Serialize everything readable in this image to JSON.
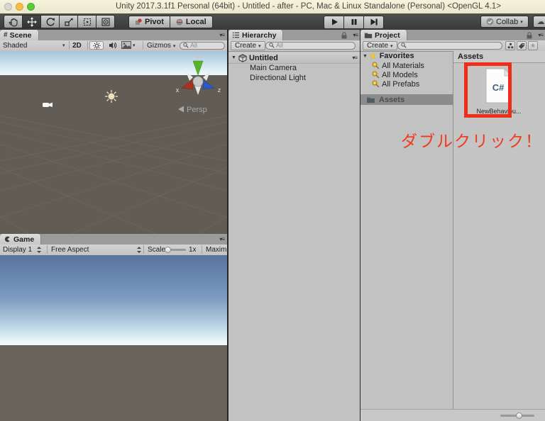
{
  "window": {
    "title": "Unity 2017.3.1f1 Personal (64bit) - Untitled - after - PC, Mac & Linux Standalone (Personal) <OpenGL 4.1>"
  },
  "toolbar": {
    "pivot": "Pivot",
    "local": "Local",
    "collab": "Collab"
  },
  "icons": {
    "dropdown": "▾",
    "panel_menu": "▾≡",
    "expanded": "▼",
    "star": "★",
    "cloud": "☁",
    "hash": "#"
  },
  "scene": {
    "tab": "Scene",
    "shaded": "Shaded",
    "btn_2d": "2D",
    "gizmos": "Gizmos",
    "search_text": "All",
    "persp": "Persp",
    "axis_x": "x",
    "axis_y": "y",
    "axis_z": "z"
  },
  "game": {
    "tab": "Game",
    "display": "Display 1",
    "aspect": "Free Aspect",
    "scale_label": "Scale",
    "scale_value": "1x",
    "maximize": "Maximiz"
  },
  "hierarchy": {
    "tab": "Hierarchy",
    "create": "Create",
    "search_text": "All",
    "scene_name": "Untitled",
    "items": [
      "Main Camera",
      "Directional Light"
    ]
  },
  "project": {
    "tab": "Project",
    "create": "Create",
    "favorites": "Favorites",
    "favorite_items": [
      "All Materials",
      "All Models",
      "All Prefabs"
    ],
    "assets_folder": "Assets",
    "assets_header": "Assets",
    "file_label": "NewBehaviou...",
    "file_icon_text": "C#",
    "annotation": "ダブルクリック！"
  },
  "colors": {
    "annotation_red": "#ee2d1a",
    "selection_gray": "#8c8c8c",
    "favorites_star": "#f3c82e"
  }
}
